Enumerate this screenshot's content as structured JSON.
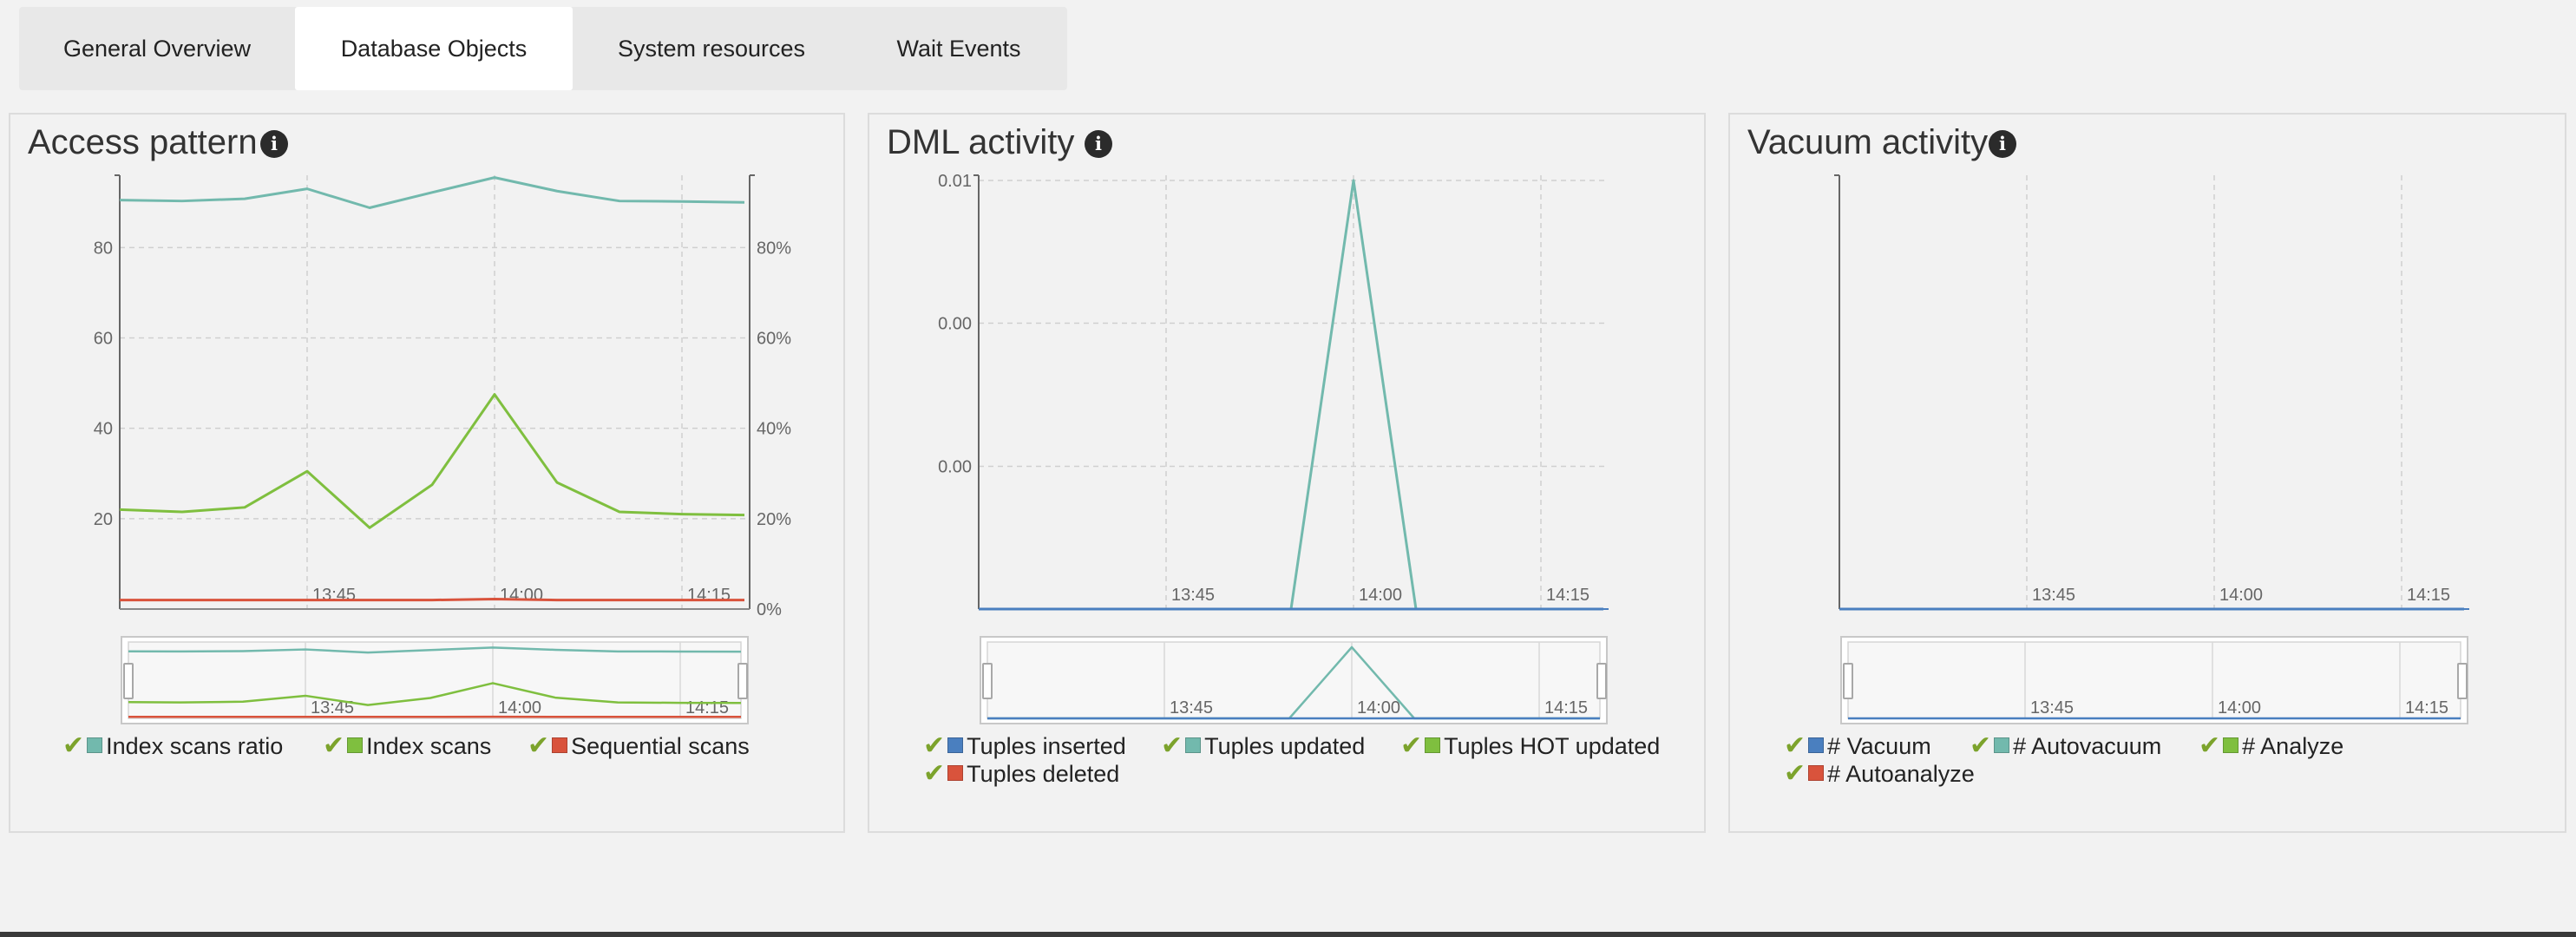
{
  "tabs": [
    "General Overview",
    "Database Objects",
    "System resources",
    "Wait Events"
  ],
  "active_tab": "Database Objects",
  "colors": {
    "teal": "#72b9ad",
    "green": "#7fbf3f",
    "red": "#d9533c",
    "blue": "#4a7fbf",
    "check": "#7ca32c"
  },
  "panels": {
    "access": {
      "title": "Access pattern",
      "info_icon": "info-icon",
      "legend": [
        {
          "label": "Index scans ratio",
          "color": "#72b9ad"
        },
        {
          "label": "Index scans",
          "color": "#7fbf3f"
        },
        {
          "label": "Sequential scans",
          "color": "#d9533c"
        }
      ]
    },
    "dml": {
      "title": "DML activity",
      "info_icon": "info-icon",
      "legend": [
        {
          "label": "Tuples inserted",
          "color": "#4a7fbf"
        },
        {
          "label": "Tuples updated",
          "color": "#72b9ad"
        },
        {
          "label": "Tuples HOT updated",
          "color": "#7fbf3f"
        },
        {
          "label": "Tuples deleted",
          "color": "#d9533c"
        }
      ]
    },
    "vacuum": {
      "title": "Vacuum activity",
      "info_icon": "info-icon",
      "legend": [
        {
          "label": "# Vacuum",
          "color": "#4a7fbf"
        },
        {
          "label": "# Autovacuum",
          "color": "#72b9ad"
        },
        {
          "label": "# Analyze",
          "color": "#7fbf3f"
        },
        {
          "label": "# Autoanalyze",
          "color": "#d9533c"
        }
      ]
    }
  },
  "chart_data": [
    {
      "type": "line",
      "title": "Access pattern",
      "x_ticks": [
        "13:45",
        "14:00",
        "14:15"
      ],
      "y_ticks_left": [
        "20",
        "40",
        "60",
        "80"
      ],
      "y_ticks_right": [
        "0%",
        "20%",
        "40%",
        "60%",
        "80%"
      ],
      "ylim_left": [
        0,
        96
      ],
      "ylim_right": [
        0,
        96
      ],
      "grid": true,
      "legend_position": "bottom",
      "series": [
        {
          "name": "Index scans ratio",
          "color": "#72b9ad",
          "axis": "right",
          "x": [
            "13:30",
            "13:35",
            "13:40",
            "13:45",
            "13:50",
            "13:55",
            "14:00",
            "14:05",
            "14:10",
            "14:15",
            "14:20"
          ],
          "values": [
            90.5,
            90.3,
            90.8,
            93,
            88.8,
            92.2,
            95.5,
            92.5,
            90.3,
            90.2,
            90
          ]
        },
        {
          "name": "Index scans",
          "color": "#7fbf3f",
          "axis": "left",
          "x": [
            "13:30",
            "13:35",
            "13:40",
            "13:45",
            "13:50",
            "13:55",
            "14:00",
            "14:05",
            "14:10",
            "14:15",
            "14:20"
          ],
          "values": [
            22,
            21.5,
            22.5,
            30.5,
            18,
            27.5,
            47.5,
            28,
            21.5,
            21,
            20.8
          ]
        },
        {
          "name": "Sequential scans",
          "color": "#d9533c",
          "axis": "left",
          "x": [
            "13:30",
            "13:35",
            "13:40",
            "13:45",
            "13:50",
            "13:55",
            "14:00",
            "14:05",
            "14:10",
            "14:15",
            "14:20"
          ],
          "values": [
            2,
            2,
            2,
            2,
            2,
            2,
            2.2,
            2,
            2,
            2,
            2
          ]
        }
      ]
    },
    {
      "type": "line",
      "title": "DML activity",
      "x_ticks": [
        "13:45",
        "14:00",
        "14:15"
      ],
      "y_ticks": [
        "0.00",
        "0.00",
        "0.01"
      ],
      "ylim": [
        0,
        0.0133
      ],
      "grid": true,
      "legend_position": "bottom",
      "series": [
        {
          "name": "Tuples updated",
          "color": "#72b9ad",
          "x": [
            "13:30",
            "13:35",
            "13:40",
            "13:45",
            "13:50",
            "13:55",
            "14:00",
            "14:05",
            "14:10",
            "14:15",
            "14:20"
          ],
          "values": [
            0,
            0,
            0,
            0,
            0,
            0,
            0.0133,
            0,
            0,
            0,
            0
          ]
        },
        {
          "name": "Tuples inserted",
          "color": "#4a7fbf",
          "x": [
            "13:30",
            "14:20"
          ],
          "values": [
            0,
            0
          ]
        }
      ]
    },
    {
      "type": "line",
      "title": "Vacuum activity",
      "x_ticks": [
        "13:45",
        "14:00",
        "14:15"
      ],
      "grid": true,
      "legend_position": "bottom",
      "series": [
        {
          "name": "# Vacuum",
          "color": "#4a7fbf",
          "x": [
            "13:30",
            "14:20"
          ],
          "values": [
            0,
            0
          ]
        }
      ]
    }
  ]
}
